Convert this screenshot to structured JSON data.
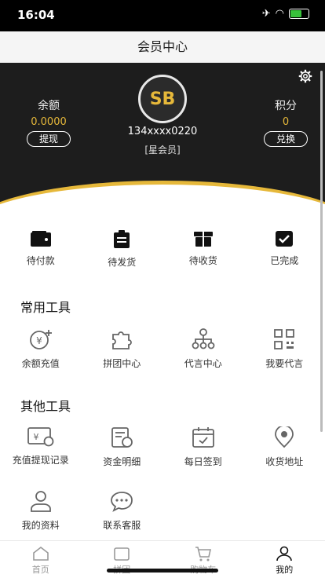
{
  "status_bar": {
    "time": "16:04"
  },
  "header": {
    "title": "会员中心"
  },
  "account": {
    "balance_label": "余额",
    "balance_value": "0.0000",
    "withdraw_label": "提现",
    "points_label": "积分",
    "points_value": "0",
    "exchange_label": "兑换",
    "phone": "134xxxx0220",
    "member_level": "[星会员]"
  },
  "orders": [
    {
      "label": "待付款",
      "icon": "wallet-icon"
    },
    {
      "label": "待发货",
      "icon": "clipboard-icon"
    },
    {
      "label": "待收货",
      "icon": "gift-box-icon"
    },
    {
      "label": "已完成",
      "icon": "checkmark-box-icon"
    }
  ],
  "common_tools": {
    "title": "常用工具",
    "items": [
      {
        "label": "余额充值",
        "icon": "yen-recharge-icon"
      },
      {
        "label": "拼团中心",
        "icon": "puzzle-icon"
      },
      {
        "label": "代言中心",
        "icon": "network-icon"
      },
      {
        "label": "我要代言",
        "icon": "qr-code-icon"
      }
    ]
  },
  "other_tools": {
    "title": "其他工具",
    "items": [
      {
        "label": "充值提现记录",
        "icon": "recharge-record-icon"
      },
      {
        "label": "资金明细",
        "icon": "bill-detail-icon"
      },
      {
        "label": "每日签到",
        "icon": "calendar-check-icon"
      },
      {
        "label": "收货地址",
        "icon": "location-pin-icon"
      },
      {
        "label": "我的资料",
        "icon": "user-profile-icon"
      },
      {
        "label": "联系客服",
        "icon": "chat-bubble-icon"
      }
    ]
  },
  "tabbar": [
    {
      "label": "首页",
      "icon": "home-icon"
    },
    {
      "label": "拼团",
      "icon": "group-ticket-icon"
    },
    {
      "label": "购物车",
      "icon": "cart-icon"
    },
    {
      "label": "我的",
      "icon": "user-icon"
    }
  ],
  "colors": {
    "accent": "#e6b83a",
    "hero_bg": "#1d1d1d"
  }
}
